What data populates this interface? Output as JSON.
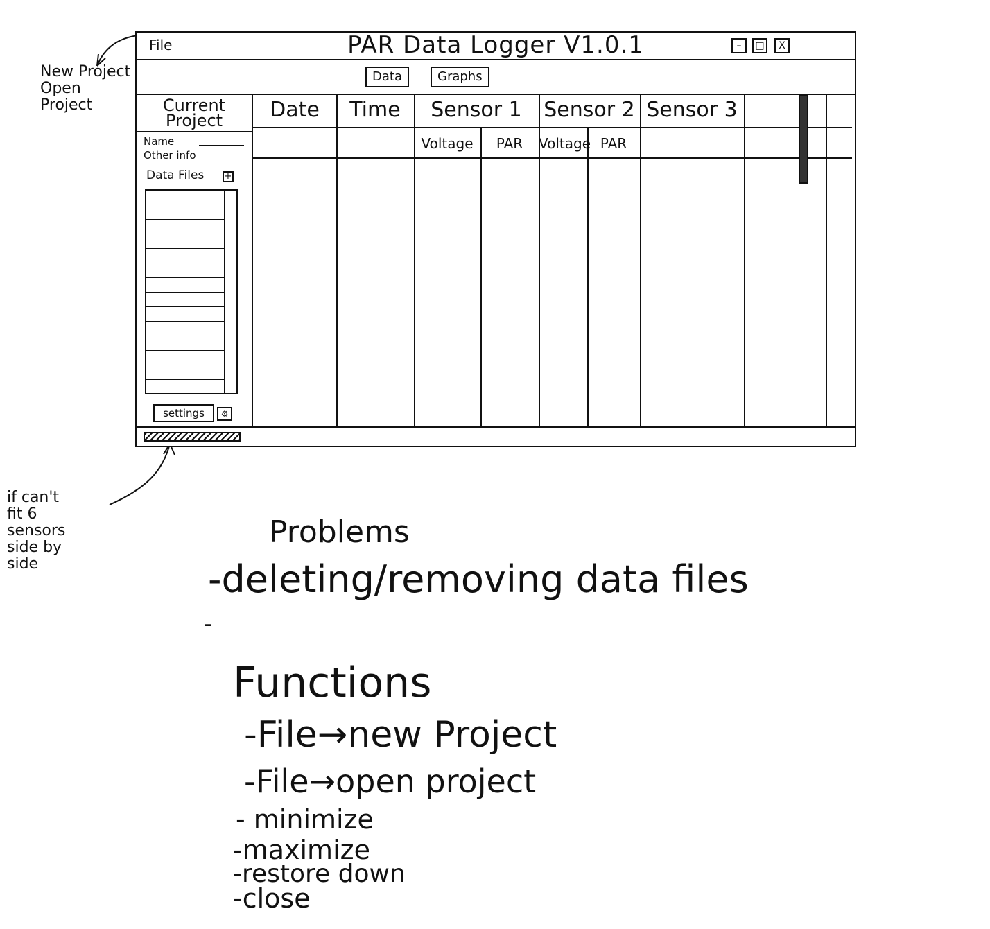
{
  "window": {
    "title": "PAR Data Logger V1.0.1",
    "file_menu": "File",
    "min_glyph": "–",
    "max_glyph": "□",
    "close_glyph": "X"
  },
  "toolbar": {
    "data_tab": "Data",
    "graphs_tab": "Graphs"
  },
  "side_panel": {
    "title": "Current Project",
    "name_label": "Name",
    "other_label": "Other info",
    "data_files_label": "Data Files",
    "add_glyph": "+",
    "settings_label": "settings",
    "settings_glyph": "⚙"
  },
  "table": {
    "headers": [
      "Date",
      "Time",
      "Sensor 1",
      "Sensor 2",
      "Sensor 3"
    ],
    "sub_headers": [
      "Voltage",
      "PAR",
      "Voltage",
      "PAR"
    ]
  },
  "annotations": {
    "file_menu_note_1": "New Project",
    "file_menu_note_2": "Open Project",
    "fit_note_1": "if can't",
    "fit_note_2": "fit 6",
    "fit_note_3": "sensors",
    "fit_note_4": "side by",
    "fit_note_5": "side"
  },
  "notes": {
    "problems_heading": "Problems",
    "problems": [
      "-deleting/removing data files",
      "-"
    ],
    "functions_heading": "Functions",
    "functions": [
      "-File→new Project",
      "-File→open project",
      "- minimize",
      "-maximize",
      "-restore down",
      "-close"
    ]
  }
}
